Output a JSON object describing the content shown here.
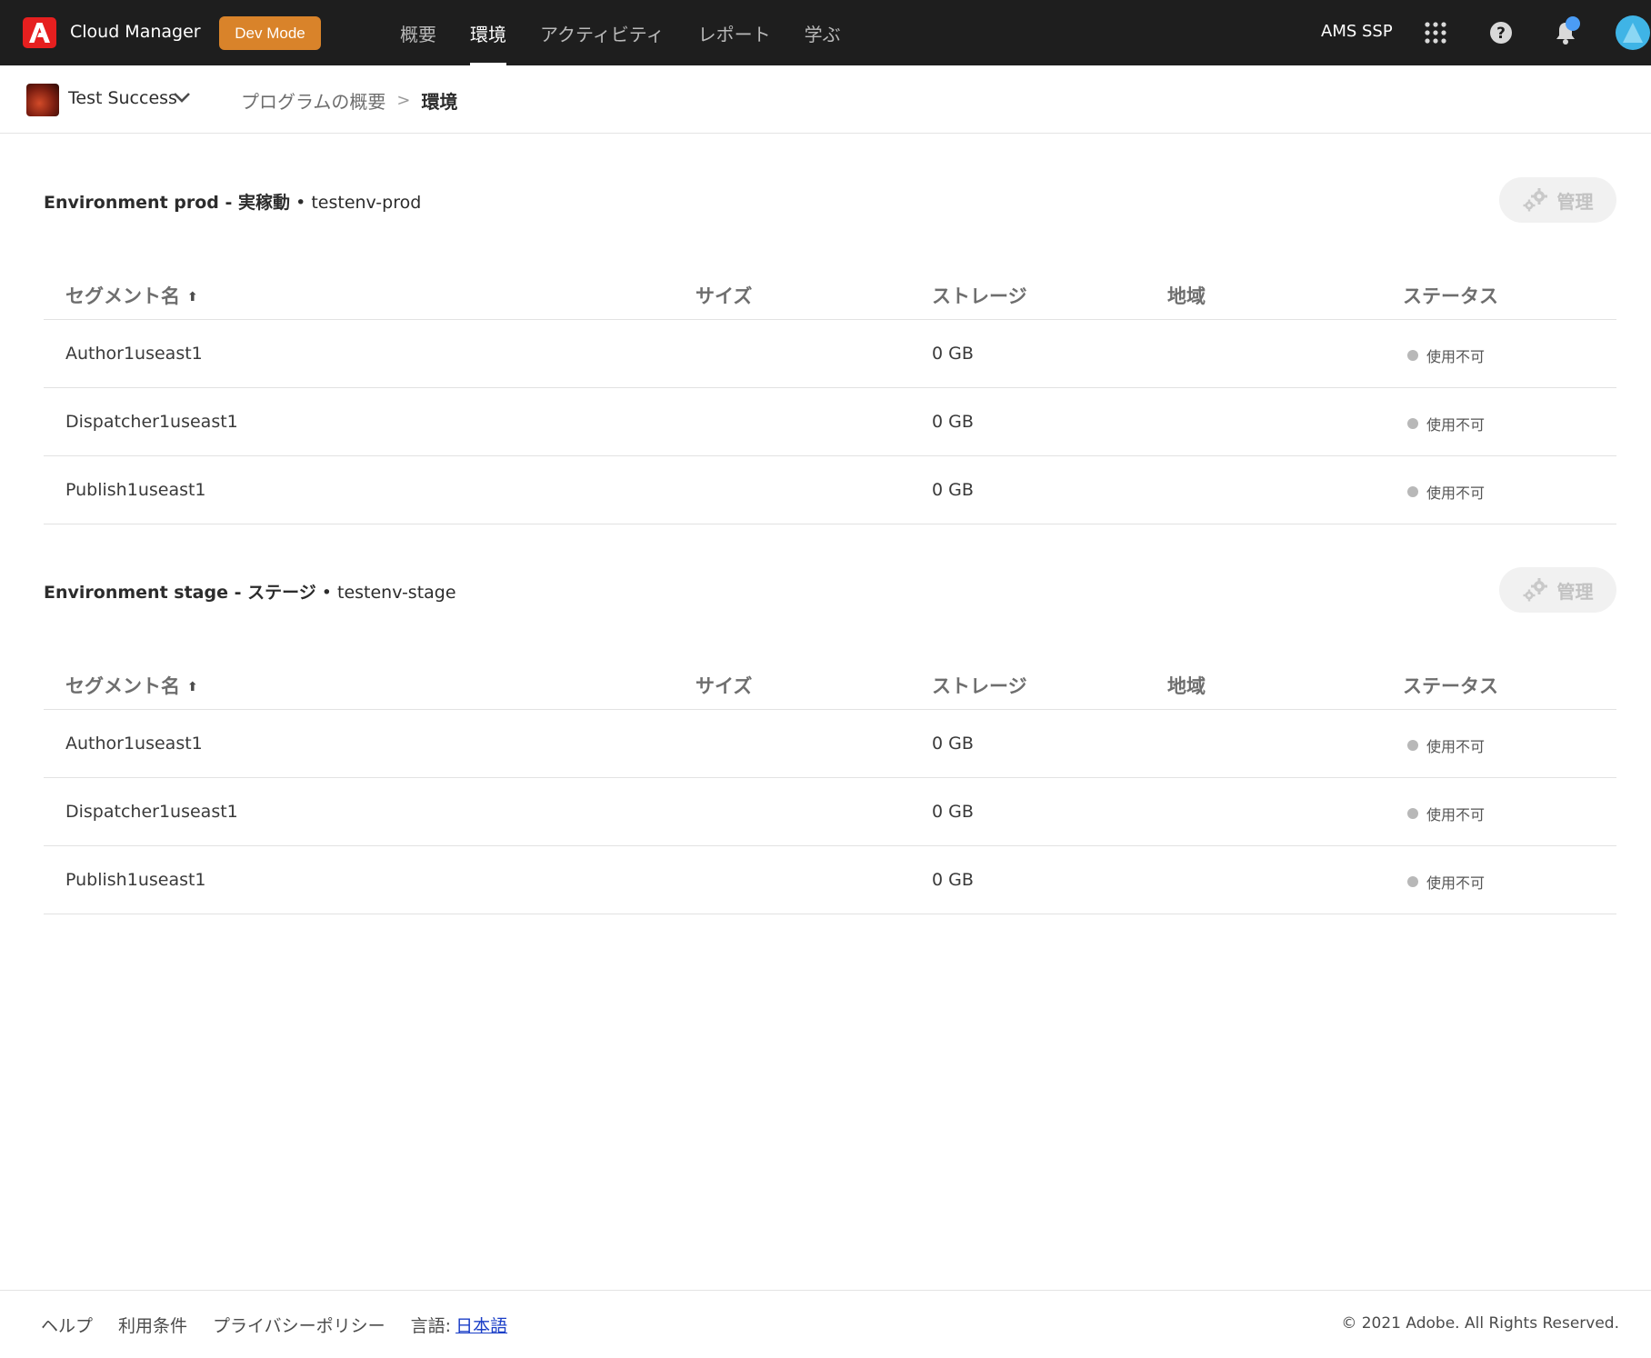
{
  "topbar": {
    "logo_icon": "adobe-logo-icon",
    "app_title": "Cloud Manager",
    "dev_mode_label": "Dev Mode",
    "nav": [
      {
        "label": "概要",
        "active": false
      },
      {
        "label": "環境",
        "active": true
      },
      {
        "label": "アクティビティ",
        "active": false
      },
      {
        "label": "レポート",
        "active": false
      },
      {
        "label": "学ぶ",
        "active": false
      }
    ],
    "org_name": "AMS SSP",
    "icons": [
      "apps-grid-icon",
      "help-icon",
      "bell-icon",
      "user-avatar"
    ],
    "accent_color": "#d9832a",
    "notification_color": "#4b9cf5"
  },
  "subbar": {
    "program_name": "Test Success",
    "breadcrumb": {
      "parent": "プログラムの概要",
      "separator": ">",
      "current": "環境"
    }
  },
  "environments": [
    {
      "name": "Environment prod - ",
      "kind": "実稼動",
      "separator": " • ",
      "id": "testenv-prod",
      "manage_label": "管理",
      "headers": {
        "name": "セグメント名",
        "size": "サイズ",
        "storage": "ストレージ",
        "region": "地域",
        "status": "ステータス"
      },
      "sort_indicator": "⬆",
      "rows": [
        {
          "name": "Author1useast1",
          "size": "",
          "storage": "0 GB",
          "region": "",
          "status": "使用不可"
        },
        {
          "name": "Dispatcher1useast1",
          "size": "",
          "storage": "0 GB",
          "region": "",
          "status": "使用不可"
        },
        {
          "name": "Publish1useast1",
          "size": "",
          "storage": "0 GB",
          "region": "",
          "status": "使用不可"
        }
      ]
    },
    {
      "name": "Environment stage - ",
      "kind": "ステージ",
      "separator": " • ",
      "id": "testenv-stage",
      "manage_label": "管理",
      "headers": {
        "name": "セグメント名",
        "size": "サイズ",
        "storage": "ストレージ",
        "region": "地域",
        "status": "ステータス"
      },
      "sort_indicator": "⬆",
      "rows": [
        {
          "name": "Author1useast1",
          "size": "",
          "storage": "0 GB",
          "region": "",
          "status": "使用不可"
        },
        {
          "name": "Dispatcher1useast1",
          "size": "",
          "storage": "0 GB",
          "region": "",
          "status": "使用不可"
        },
        {
          "name": "Publish1useast1",
          "size": "",
          "storage": "0 GB",
          "region": "",
          "status": "使用不可"
        }
      ]
    }
  ],
  "footer": {
    "links": [
      "ヘルプ",
      "利用条件",
      "プライバシーポリシー"
    ],
    "language_label": "言語:",
    "language_value": "日本語",
    "copyright": "© 2021 Adobe. All Rights Reserved."
  }
}
